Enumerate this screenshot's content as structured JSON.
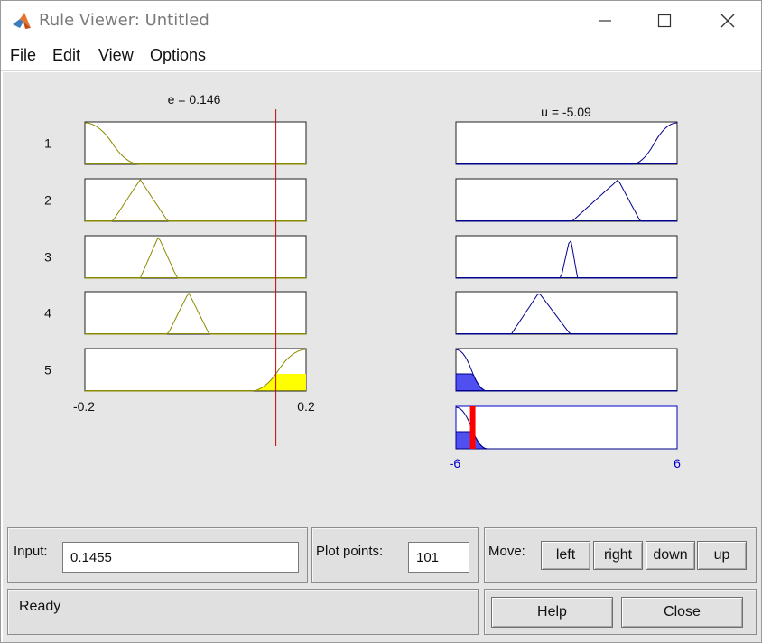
{
  "window": {
    "title": "Rule Viewer: Untitled",
    "controls": {
      "minimize": "minimize",
      "maximize": "maximize",
      "close": "close"
    }
  },
  "menu": {
    "items": [
      {
        "label": "File"
      },
      {
        "label": "Edit"
      },
      {
        "label": "View"
      },
      {
        "label": "Options"
      }
    ]
  },
  "viewer": {
    "input_title": "e = 0.146",
    "output_title": "u = -5.09",
    "rule_numbers": [
      "1",
      "2",
      "3",
      "4",
      "5"
    ],
    "input_range": {
      "min_label": "-0.2",
      "max_label": "0.2",
      "min": -0.2,
      "max": 0.2
    },
    "output_range": {
      "min_label": "-6",
      "max_label": "6",
      "min": -6,
      "max": 6
    },
    "input_value": 0.1455,
    "output_value": -5.09,
    "colors": {
      "input_mf": "#8a8a00",
      "output_mf": "#00008b",
      "fired_input_fill": "#ffff00",
      "fired_output_fill": "#5050f0",
      "cursor_line": "#cc0000",
      "output_marker": "#ff0000"
    }
  },
  "controls": {
    "input_label": "Input:",
    "input_value": "0.1455",
    "plot_points_label": "Plot points:",
    "plot_points_value": "101",
    "move_label": "Move:",
    "move_buttons": [
      {
        "label": "left"
      },
      {
        "label": "right"
      },
      {
        "label": "down"
      },
      {
        "label": "up"
      }
    ],
    "status": "Ready",
    "help_label": "Help",
    "close_label": "Close"
  }
}
